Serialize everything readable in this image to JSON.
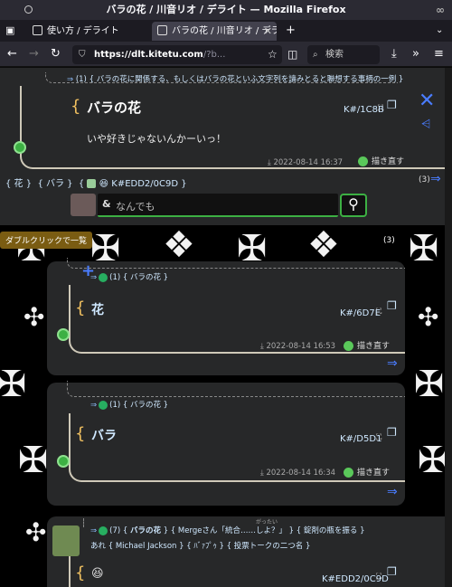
{
  "window": {
    "title": "バラの花 / 川音リオ / デライト — Mozilla Firefox"
  },
  "tabs": [
    {
      "label": "使い方 / デライト"
    },
    {
      "label": "バラの花 / 川音リオ / デライト"
    }
  ],
  "nav": {
    "url_host": "https://dlt.kitetu.com",
    "url_rest": "/?b...",
    "search_placeholder": "検索"
  },
  "top_card": {
    "parent_count": "(1)",
    "parent_text": "{ バラの花に関係する、もしくはバラの花といふ文字列を讀みとると聯想する事柄の一例 }",
    "title": "バラの花",
    "id": "K#/1C8B",
    "body": "いや好きじゃないんかーいっ！",
    "date": "2022-08-14 16:37",
    "redraw": "描き直す"
  },
  "tags": {
    "items": [
      "{ 花 }",
      "{ バラ }"
    ],
    "current": "K#EDD2/0C9D",
    "count": "(3)"
  },
  "input": {
    "prefix": "&",
    "placeholder": "なんでも"
  },
  "tooltip": "ダブルクリックで一覧",
  "side_count": "(3)",
  "card2": {
    "parent_count": "(1)",
    "parent_text": "{ バラの花 }",
    "title": "花",
    "id": "K#/6D7E",
    "date": "2022-08-14 16:53",
    "redraw": "描き直す"
  },
  "card3": {
    "parent_count": "(1)",
    "parent_text": "{ バラの花 }",
    "title": "バラ",
    "id": "K#/D5D1",
    "date": "2022-08-14 16:34",
    "redraw": "描き直す"
  },
  "card4": {
    "count": "(7)",
    "row1_a": "バラの花",
    "row1_b": "Mergeさん「統合……しよ？」",
    "row1_c": "錠剤の瓶を振る",
    "row1_ruby": "がったい",
    "row2_a": "あれ",
    "row2_b": "Michael Jackson",
    "row2_c": "ﾊﾞｧﾌﾟｩ",
    "row2_d": "投票トークの二つ名",
    "id": "K#EDD2/0C9D"
  },
  "colors": {
    "accent": "#f0c060",
    "link": "#4a7dff",
    "brand": "#3cb043"
  }
}
